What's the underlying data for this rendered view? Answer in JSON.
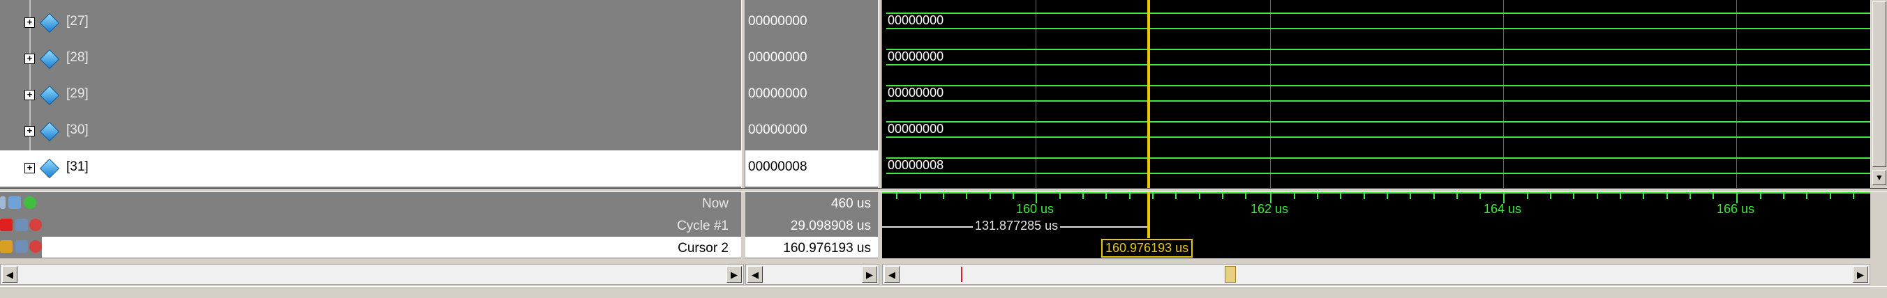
{
  "signals": [
    {
      "label": "[27]",
      "value": "00000000",
      "wave_value": "00000000",
      "selected": false
    },
    {
      "label": "[28]",
      "value": "00000000",
      "wave_value": "00000000",
      "selected": false
    },
    {
      "label": "[29]",
      "value": "00000000",
      "wave_value": "00000000",
      "selected": false
    },
    {
      "label": "[30]",
      "value": "00000000",
      "wave_value": "00000000",
      "selected": false
    },
    {
      "label": "[31]",
      "value": "00000008",
      "wave_value": "00000008",
      "selected": true
    }
  ],
  "cursors": {
    "now": {
      "label": "Now",
      "value": "460 us"
    },
    "cycle": {
      "label": "Cycle #1",
      "value": "29.098908 us"
    },
    "cursor2": {
      "label": "Cursor 2",
      "value": "160.976193 us"
    }
  },
  "timeline": {
    "ticks": [
      "160 us",
      "162 us",
      "164 us",
      "166 us"
    ],
    "delta_label": "131.877285 us",
    "cursor_time_label": "160.976193 us"
  },
  "icons": {
    "expander": "plus-box-icon",
    "signal": "signal-diamond-icon",
    "lock_red": "lock-icon",
    "lock_gold": "lock-icon",
    "wrench": "wrench-icon",
    "remove": "remove-circle-icon",
    "add": "add-circle-icon"
  },
  "colors": {
    "wave": "#3ee83e",
    "cursor": "#e8c800",
    "background": "#000000",
    "pane": "#808080"
  }
}
